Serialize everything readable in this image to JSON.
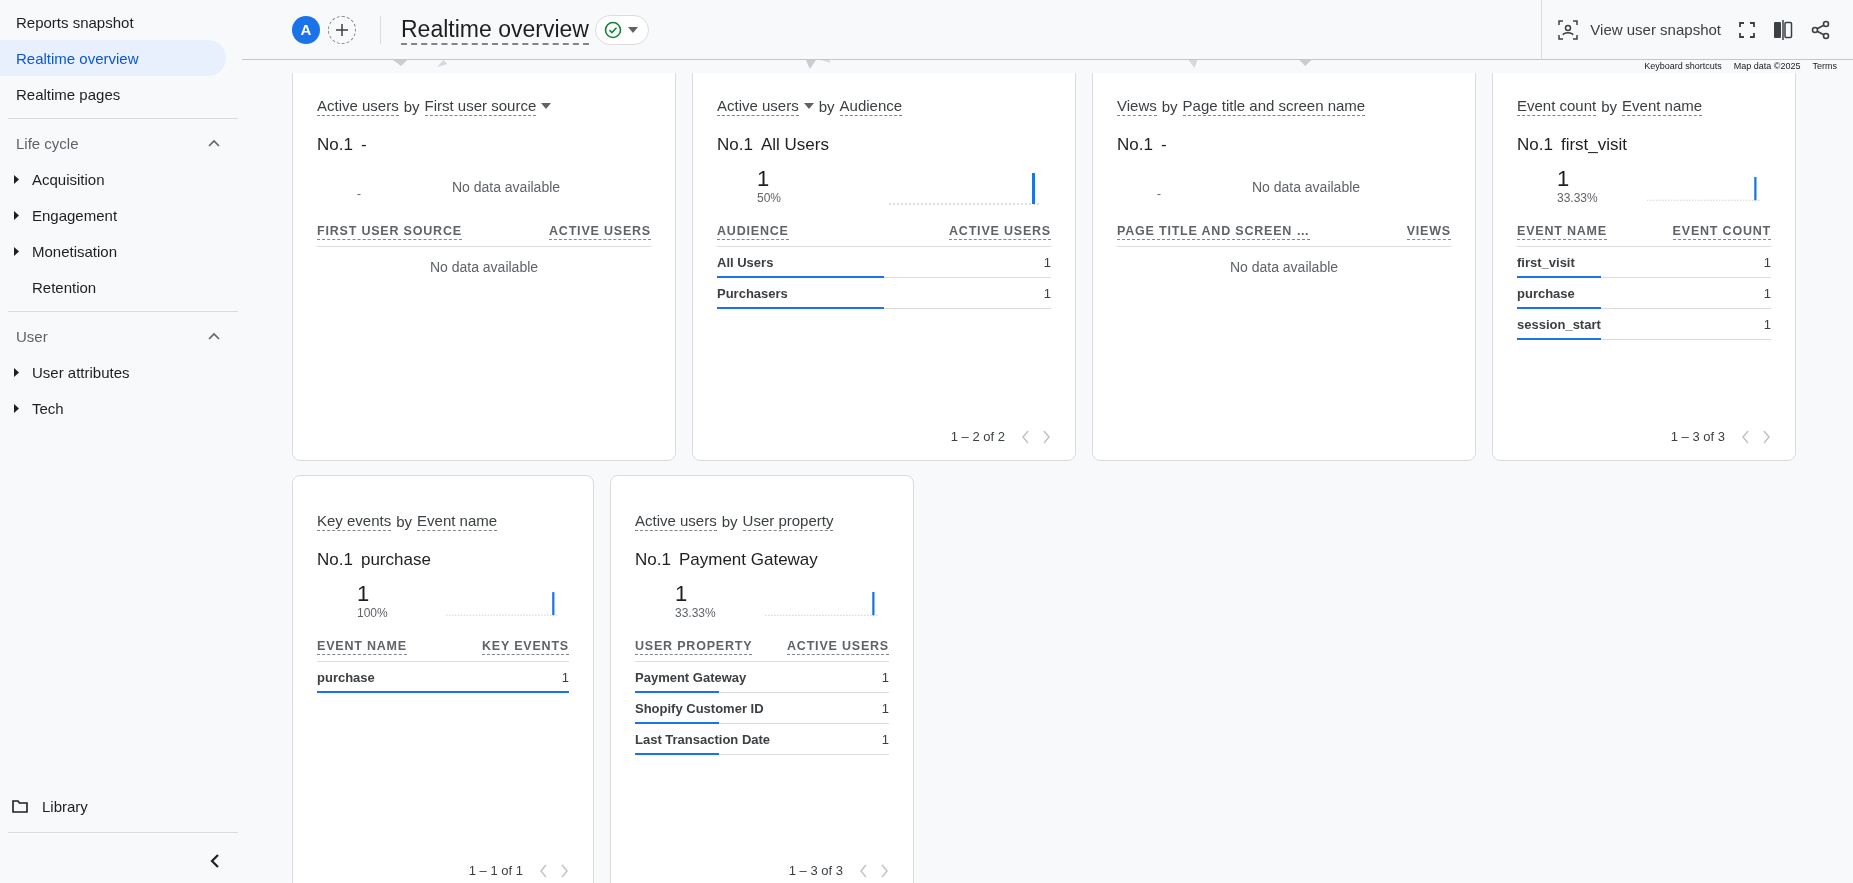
{
  "sidebar": {
    "items": [
      {
        "label": "Reports snapshot",
        "selected": false
      },
      {
        "label": "Realtime overview",
        "selected": true
      },
      {
        "label": "Realtime pages",
        "selected": false
      }
    ],
    "sections": [
      {
        "title": "Life cycle",
        "expanded": true,
        "items": [
          {
            "label": "Acquisition",
            "has_children": true
          },
          {
            "label": "Engagement",
            "has_children": true
          },
          {
            "label": "Monetisation",
            "has_children": true
          },
          {
            "label": "Retention",
            "has_children": false
          }
        ]
      },
      {
        "title": "User",
        "expanded": true,
        "items": [
          {
            "label": "User attributes",
            "has_children": true
          },
          {
            "label": "Tech",
            "has_children": true
          }
        ]
      }
    ],
    "library": "Library"
  },
  "header": {
    "avatar": "A",
    "title": "Realtime overview",
    "actions": {
      "snapshot": "View user snapshot"
    }
  },
  "map_attribution": [
    "Keyboard shortcuts",
    "Map data ©2025",
    "Terms"
  ],
  "cards": [
    {
      "metric": "Active users",
      "by": "by",
      "dimension": "First user source",
      "dimension_dropdown": true,
      "rank": "No.1",
      "top": "-",
      "summary": {
        "kind": "empty",
        "dash": "-",
        "message": "No data available"
      },
      "columns": [
        "FIRST USER SOURCE",
        "ACTIVE USERS"
      ],
      "empty_message": "No data available"
    },
    {
      "metric": "Active users",
      "by": "by",
      "dimension": "Audience",
      "metric_dropdown": true,
      "rank": "No.1",
      "top": "All Users",
      "summary": {
        "kind": "value",
        "value": "1",
        "share": "50%"
      },
      "columns": [
        "AUDIENCE",
        "ACTIVE USERS"
      ],
      "rows": [
        {
          "label": "All Users",
          "value": "1",
          "level": 0.5
        },
        {
          "label": "Purchasers",
          "value": "1",
          "level": 0.5
        }
      ],
      "pagination": "1 – 2 of 2"
    },
    {
      "metric": "Views",
      "by": "by",
      "dimension": "Page title and screen name",
      "rank": "No.1",
      "top": "-",
      "summary": {
        "kind": "empty",
        "dash": "-",
        "message": "No data available"
      },
      "columns": [
        "PAGE TITLE AND SCREEN …",
        "VIEWS"
      ],
      "empty_message": "No data available"
    },
    {
      "metric": "Event count",
      "by": "by",
      "dimension": "Event name",
      "rank": "No.1",
      "top": "first_visit",
      "summary": {
        "kind": "value",
        "value": "1",
        "share": "33.33%"
      },
      "columns": [
        "EVENT NAME",
        "EVENT COUNT"
      ],
      "rows": [
        {
          "label": "first_visit",
          "value": "1",
          "level": 0.33
        },
        {
          "label": "purchase",
          "value": "1",
          "level": 0.33
        },
        {
          "label": "session_start",
          "value": "1",
          "level": 0.33
        }
      ],
      "pagination": "1 – 3 of 3"
    },
    {
      "metric": "Key events",
      "by": "by",
      "dimension": "Event name",
      "rank": "No.1",
      "top": "purchase",
      "summary": {
        "kind": "value",
        "value": "1",
        "share": "100%"
      },
      "columns": [
        "EVENT NAME",
        "KEY EVENTS"
      ],
      "rows": [
        {
          "label": "purchase",
          "value": "1",
          "level": 1
        }
      ],
      "pagination": "1 – 1 of 1"
    },
    {
      "metric": "Active users",
      "by": "by",
      "dimension": "User property",
      "rank": "No.1",
      "top": "Payment Gateway",
      "summary": {
        "kind": "value",
        "value": "1",
        "share": "33.33%"
      },
      "columns": [
        "USER PROPERTY",
        "ACTIVE USERS"
      ],
      "rows": [
        {
          "label": "Payment Gateway",
          "value": "1",
          "level": 0.33
        },
        {
          "label": "Shopify Customer ID",
          "value": "1",
          "level": 0.33
        },
        {
          "label": "Last Transaction Date",
          "value": "1",
          "level": 0.33
        }
      ],
      "pagination": "1 – 3 of 3"
    }
  ]
}
